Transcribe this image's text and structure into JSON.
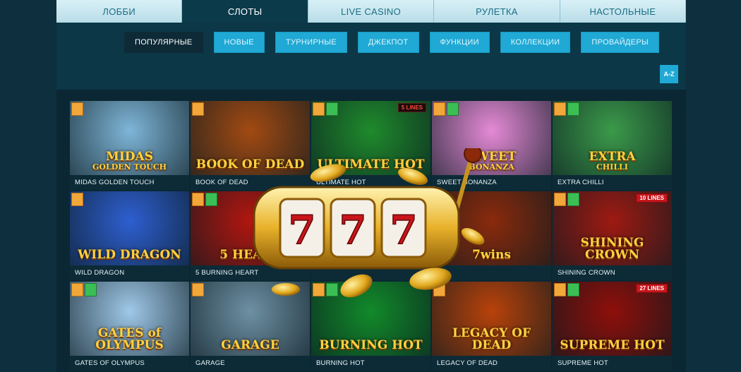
{
  "tabs": [
    {
      "label": "ЛОББИ",
      "active": false
    },
    {
      "label": "СЛОТЫ",
      "active": true
    },
    {
      "label": "LIVE CASINO",
      "active": false
    },
    {
      "label": "РУЛЕТКА",
      "active": false
    },
    {
      "label": "НАСТОЛЬНЫЕ",
      "active": false
    }
  ],
  "filters": [
    {
      "label": "ПОПУЛЯРНЫЕ",
      "active": true
    },
    {
      "label": "НОВЫЕ",
      "active": false
    },
    {
      "label": "ТУРНИРНЫЕ",
      "active": false
    },
    {
      "label": "ДЖЕКПОТ",
      "active": false
    },
    {
      "label": "ФУНКЦИИ",
      "active": false
    },
    {
      "label": "КОЛЛЕКЦИИ",
      "active": false
    },
    {
      "label": "ПРОВАЙДЕРЫ",
      "active": false
    }
  ],
  "sort_button": "A-Z",
  "games": [
    {
      "title": "MIDAS GOLDEN TOUCH",
      "art": "MIDAS",
      "art2": "GOLDEN TOUCH",
      "bg": "#7fb6d8",
      "new": false,
      "lines": ""
    },
    {
      "title": "BOOK OF DEAD",
      "art": "BOOK OF DEAD",
      "art2": "",
      "bg": "#a24a12",
      "new": false,
      "lines": ""
    },
    {
      "title": "ULTIMATE HOT",
      "art": "ULTIMATE HOT",
      "art2": "",
      "bg": "#1f8a2c",
      "new": true,
      "lines": "5 LINES"
    },
    {
      "title": "SWEET BONANZA",
      "art": "SWEET",
      "art2": "BONANZA",
      "bg": "#e58ad6",
      "new": true,
      "lines": ""
    },
    {
      "title": "EXTRA CHILLI",
      "art": "EXTRA",
      "art2": "CHILLI",
      "bg": "#3b9a4a",
      "new": true,
      "lines": ""
    },
    {
      "title": "WILD DRAGON",
      "art": "WILD DRAGON",
      "art2": "",
      "bg": "#2e5fd0",
      "new": false,
      "lines": ""
    },
    {
      "title": "5 BURNING HEART",
      "art": "5 HEART",
      "art2": "",
      "bg": "#b3160f",
      "new": true,
      "lines": ""
    },
    {
      "title": "",
      "art": "",
      "art2": "",
      "bg": "#1c6a8a",
      "new": false,
      "lines": ""
    },
    {
      "title": "",
      "art": "7wins",
      "art2": "",
      "bg": "#8a2a0c",
      "new": false,
      "lines": ""
    },
    {
      "title": "SHINING CROWN",
      "art": "SHINING CROWN",
      "art2": "",
      "bg": "#9e1a12",
      "new": true,
      "lines": "10 LINES"
    },
    {
      "title": "GATES OF OLYMPUS",
      "art": "GATES of OLYMPUS",
      "art2": "",
      "bg": "#9fc8e8",
      "new": true,
      "lines": ""
    },
    {
      "title": "GARAGE",
      "art": "GARAGE",
      "art2": "",
      "bg": "#6e90a4",
      "new": false,
      "lines": ""
    },
    {
      "title": "BURNING HOT",
      "art": "BURNING HOT",
      "art2": "",
      "bg": "#128a2a",
      "new": true,
      "lines": ""
    },
    {
      "title": "LEGACY OF DEAD",
      "art": "LEGACY OF DEAD",
      "art2": "",
      "bg": "#b8420a",
      "new": false,
      "lines": ""
    },
    {
      "title": "SUPREME HOT",
      "art": "SUPREME HOT",
      "art2": "",
      "bg": "#8e0f0a",
      "new": true,
      "lines": "27 LINES"
    }
  ],
  "overlay": {
    "digits": [
      "7",
      "7",
      "7"
    ]
  },
  "colors": {
    "accent": "#1fa9d4",
    "active_tab": "#0b3a4a",
    "background": "#0e2f3d"
  }
}
